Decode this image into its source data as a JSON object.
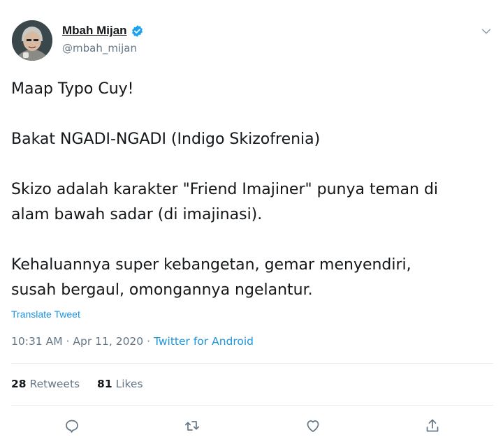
{
  "user": {
    "display_name": "Mbah Mijan",
    "handle": "@mbah_mijan",
    "verified": true
  },
  "tweet": {
    "lines": [
      "Maap Typo Cuy!",
      "Bakat NGADI-NGADI (Indigo Skizofrenia)",
      "Skizo adalah karakter \"Friend Imajiner\" punya teman di",
      "alam bawah sadar (di imajinasi).",
      "Kehaluannya super kebangetan, gemar menyendiri,",
      "susah bergaul, omongannya ngelantur."
    ],
    "translate_label": "Translate Tweet",
    "time": "10:31 AM",
    "date": "Apr 11, 2020",
    "source": "Twitter for Android",
    "separator": "·"
  },
  "stats": {
    "retweets_count": "28",
    "retweets_label": "Retweets",
    "likes_count": "81",
    "likes_label": "Likes"
  },
  "actions": [
    "reply-icon",
    "retweet-icon",
    "like-icon",
    "share-icon"
  ],
  "colors": {
    "text": "#14171a",
    "secondary": "#657786",
    "link": "#1b95e0",
    "verified": "#1da1f2",
    "divider": "#e6ecf0"
  }
}
